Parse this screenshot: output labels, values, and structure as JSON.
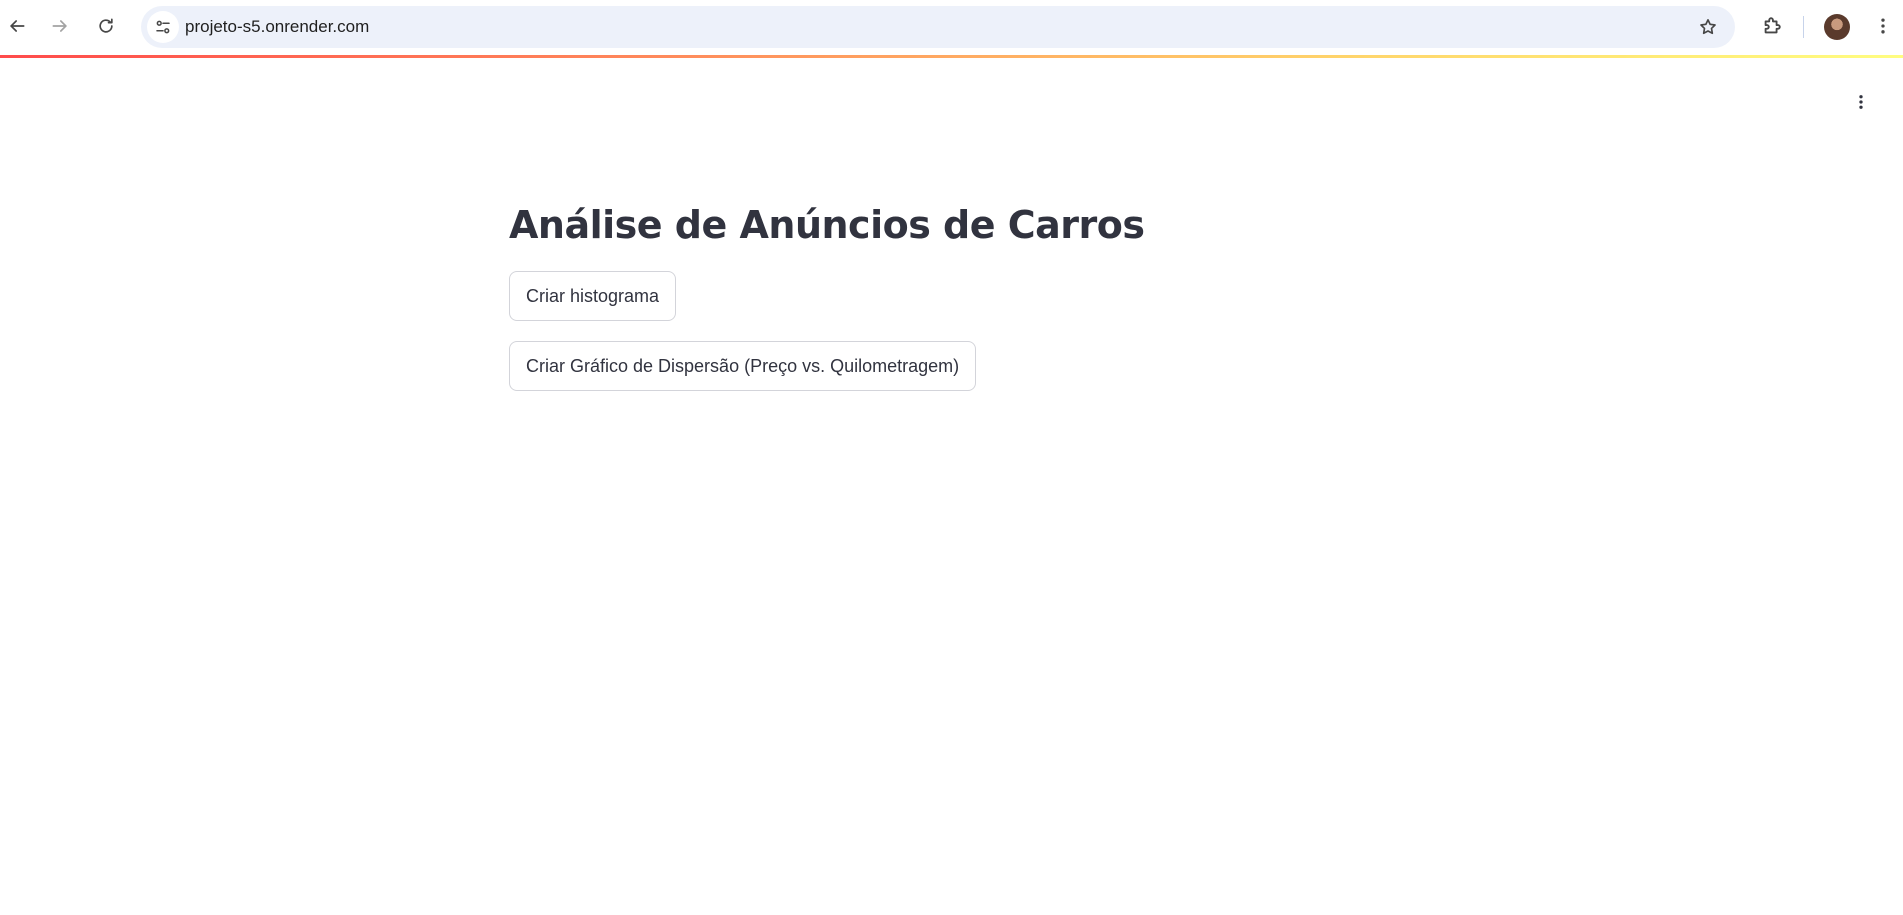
{
  "browser": {
    "url": "projeto-s5.onrender.com",
    "icons": {
      "back": "arrow-left-icon",
      "forward": "arrow-right-icon",
      "reload": "reload-icon",
      "site_info": "tune-icon",
      "bookmark": "star-icon",
      "extensions": "puzzle-icon",
      "menu": "kebab-menu-icon"
    }
  },
  "app": {
    "accent_gradient": [
      "#ff4b4b",
      "#ffd36a",
      "#fffd80"
    ],
    "menu_icon": "kebab-menu-icon",
    "title": "Análise de Anúncios de Carros",
    "buttons": {
      "histogram": "Criar histograma",
      "scatter": "Criar Gráfico de Dispersão (Preço vs. Quilometragem)"
    }
  }
}
